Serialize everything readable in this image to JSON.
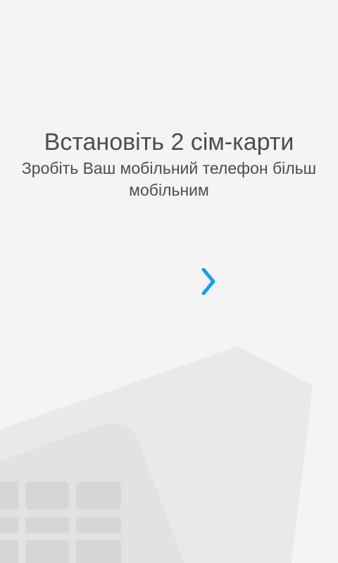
{
  "promo": {
    "title": "Встановіть 2 сім-карти",
    "subtitle": "Зробіть Ваш мобільний телефон більш мобільним"
  },
  "next_button": {
    "icon": "chevron-right-icon",
    "color": "#1e9be6"
  },
  "colors": {
    "background": "#f4f4f4",
    "illustration": "#e6e6e6",
    "text": "#4d4d4d"
  }
}
